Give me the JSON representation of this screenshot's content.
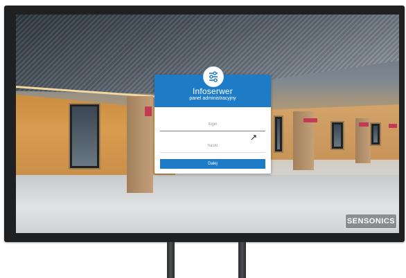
{
  "login": {
    "title": "Infoserwer",
    "subtitle": "panel administracyjny",
    "login_placeholder": "login",
    "password_placeholder": "hasło",
    "submit_label": "Dalej",
    "accent_color": "#1e7bc6"
  },
  "brand": {
    "label": "SENSONICS"
  },
  "icons": {
    "logo": "sliders-icon",
    "cursor": "mouse-cursor-icon"
  }
}
